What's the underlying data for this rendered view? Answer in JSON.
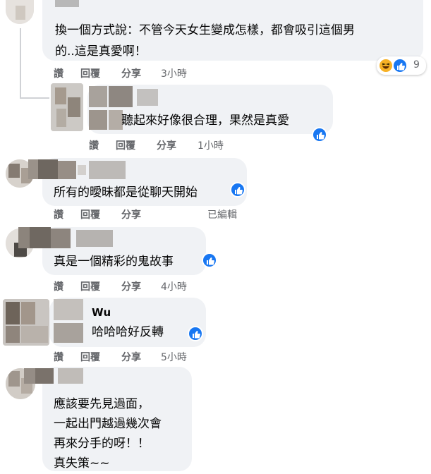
{
  "labels": {
    "like": "讚",
    "reply": "回覆",
    "share": "分享"
  },
  "comments": [
    {
      "name_partial": "",
      "lines": [
        "換一個方式說：不管今天女生變成怎樣，都會吸引這個男",
        "的..這是真愛啊！"
      ],
      "time": "3小時",
      "reaction_count": "9",
      "reactions": [
        "haha-icon",
        "like-icon"
      ]
    },
    {
      "name_partial": "",
      "lines": [
        "聽起來好像很合理，果然是真愛"
      ],
      "time": "1小時",
      "reactions": [
        "like-icon"
      ]
    },
    {
      "name_partial": "",
      "lines": [
        "所有的曖昧都是從聊天開始"
      ],
      "time": "已編輯",
      "reactions": [
        "like-icon"
      ]
    },
    {
      "name_partial": "",
      "lines": [
        "真是一個精彩的鬼故事"
      ],
      "time": "4小時",
      "reactions": [
        "like-icon"
      ]
    },
    {
      "name_partial": "Wu",
      "lines": [
        "哈哈哈好反轉"
      ],
      "time": "5小時",
      "reactions": [
        "like-icon"
      ]
    },
    {
      "name_partial": "",
      "lines": [
        "應該要先見過面，",
        "一起出門越過幾次會",
        "再來分手的呀！！",
        "真失策~~"
      ]
    }
  ],
  "colors": {
    "bubble": "#f0f2f5",
    "action_text": "#65676b",
    "like_blue": "#1877f2",
    "haha_yellow": "#f7b125"
  }
}
